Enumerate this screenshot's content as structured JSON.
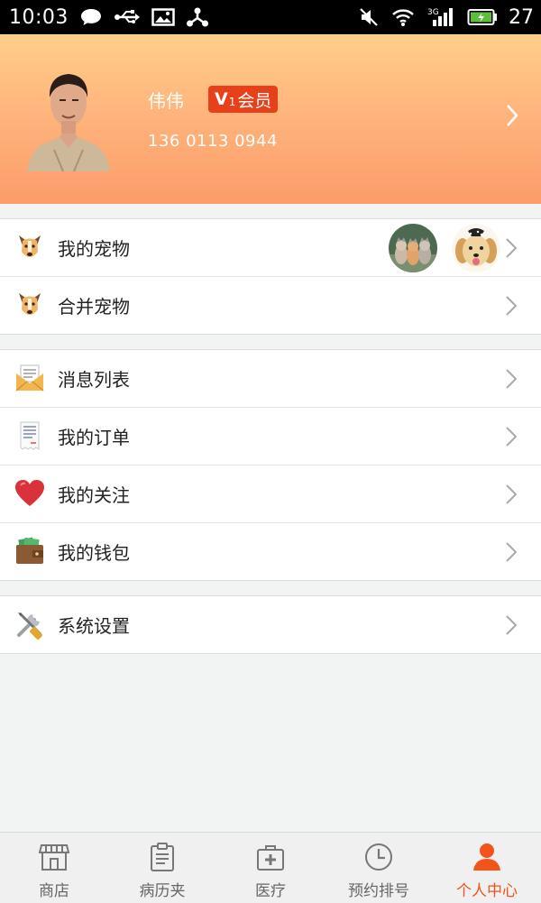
{
  "status_bar": {
    "time": "10:03",
    "battery_percent": "27",
    "left_icons": [
      "chat-icon",
      "usb-icon",
      "image-icon",
      "share-icon"
    ],
    "right_icons": [
      "mute-icon",
      "wifi-icon",
      "signal-3g-icon",
      "battery-icon"
    ]
  },
  "profile": {
    "name": "伟伟",
    "vip_letter": "V",
    "vip_level": "1",
    "vip_text": "会员",
    "phone": "136 0113 0944"
  },
  "menu": {
    "my_pets": "我的宠物",
    "merge_pets": "合并宠物",
    "messages": "消息列表",
    "my_orders": "我的订单",
    "my_follows": "我的关注",
    "my_wallet": "我的钱包",
    "settings": "系统设置"
  },
  "tabs": [
    {
      "label": "商店",
      "icon": "store-icon"
    },
    {
      "label": "病历夹",
      "icon": "clipboard-icon"
    },
    {
      "label": "医疗",
      "icon": "medical-kit-icon"
    },
    {
      "label": "预约排号",
      "icon": "clock-icon"
    },
    {
      "label": "个人中心",
      "icon": "person-icon"
    }
  ],
  "colors": {
    "header_gradient_top": "#ffcf8a",
    "header_gradient_bottom": "#fc9c6a",
    "vip_badge": "#e8411a",
    "active_tab": "#f2541c"
  }
}
